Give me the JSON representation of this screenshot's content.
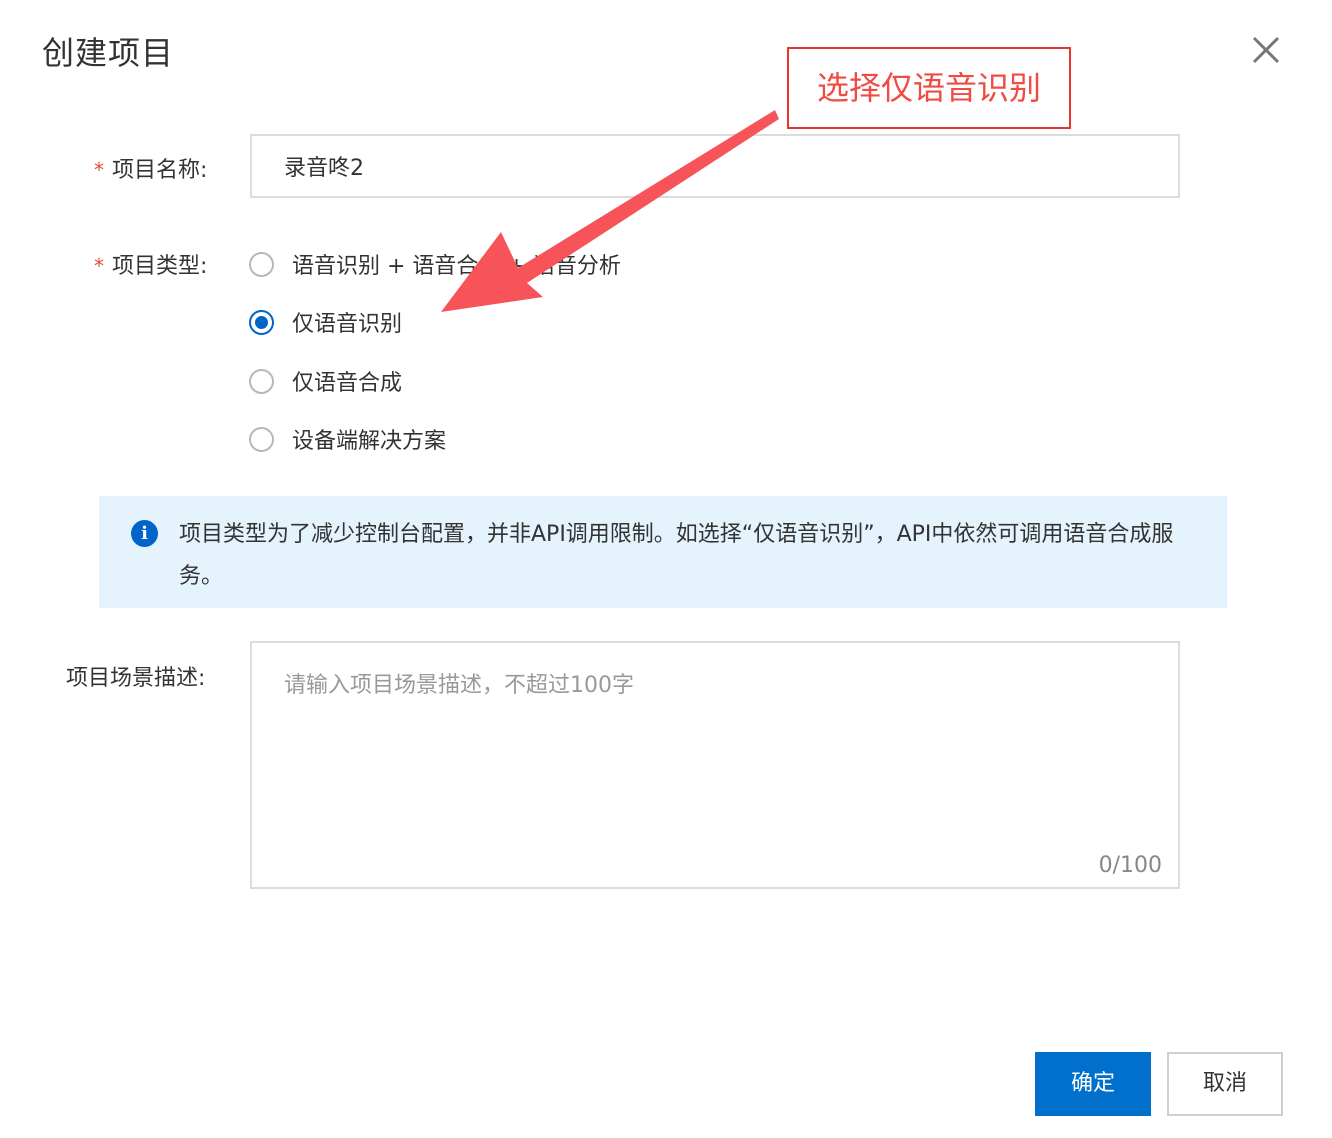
{
  "dialog": {
    "title": "创建项目",
    "close_icon": "close-icon"
  },
  "form": {
    "name_label": "项目名称:",
    "name_value": "录音咚2",
    "type_label": "项目类型:",
    "type_options": [
      {
        "label": "语音识别 + 语音合成 + 语音分析",
        "checked": false
      },
      {
        "label": "仅语音识别",
        "checked": true
      },
      {
        "label": "仅语音合成",
        "checked": false
      },
      {
        "label": "设备端解决方案",
        "checked": false
      }
    ],
    "desc_label": "项目场景描述:",
    "desc_placeholder": "请输入项目场景描述，不超过100字",
    "desc_counter": "0/100"
  },
  "info": {
    "icon": "info-icon",
    "text": "项目类型为了减少控制台配置，并非API调用限制。如选择“仅语音识别”，API中依然可调用语音合成服务。"
  },
  "footer": {
    "ok_label": "确定",
    "cancel_label": "取消"
  },
  "annotation": {
    "text": "选择仅语音识别",
    "color": "#f04b43"
  },
  "colors": {
    "primary": "#0070cc",
    "required": "#e84e40",
    "info_bg": "#e5f3fd"
  }
}
